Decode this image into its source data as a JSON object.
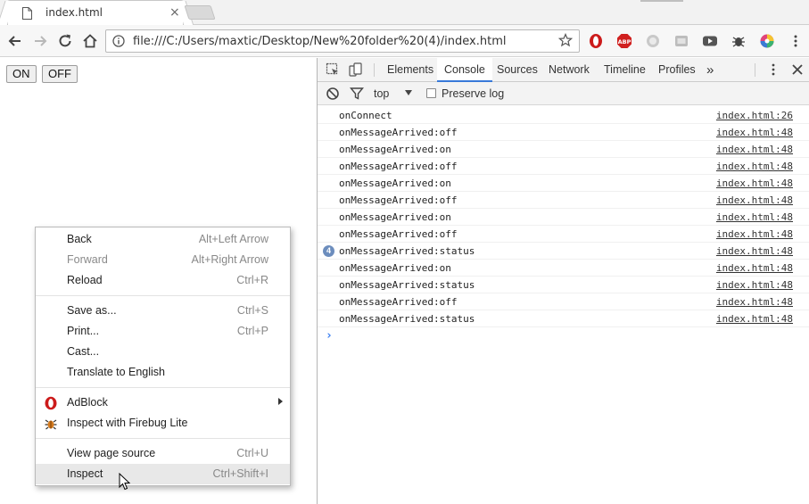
{
  "browser": {
    "tab_title": "index.html",
    "tab_close": "×",
    "url": "file:///C:/Users/maxtic/Desktop/New%20folder%20(4)/index.html"
  },
  "page": {
    "buttons": [
      "ON",
      "OFF"
    ]
  },
  "devtools": {
    "tabs": [
      "Elements",
      "Console",
      "Sources",
      "Network",
      "Timeline",
      "Profiles"
    ],
    "active_tab": "Console",
    "more": "»",
    "context": "top",
    "preserve_log": "Preserve log",
    "preserve_log_checked": false,
    "console_rows": [
      {
        "msg": "onConnect",
        "src": "index.html:26",
        "count": ""
      },
      {
        "msg": "onMessageArrived:off",
        "src": "index.html:48",
        "count": ""
      },
      {
        "msg": "onMessageArrived:on",
        "src": "index.html:48",
        "count": ""
      },
      {
        "msg": "onMessageArrived:off",
        "src": "index.html:48",
        "count": ""
      },
      {
        "msg": "onMessageArrived:on",
        "src": "index.html:48",
        "count": ""
      },
      {
        "msg": "onMessageArrived:off",
        "src": "index.html:48",
        "count": ""
      },
      {
        "msg": "onMessageArrived:on",
        "src": "index.html:48",
        "count": ""
      },
      {
        "msg": "onMessageArrived:off",
        "src": "index.html:48",
        "count": ""
      },
      {
        "msg": "onMessageArrived:status",
        "src": "index.html:48",
        "count": "4"
      },
      {
        "msg": "onMessageArrived:on",
        "src": "index.html:48",
        "count": ""
      },
      {
        "msg": "onMessageArrived:status",
        "src": "index.html:48",
        "count": ""
      },
      {
        "msg": "onMessageArrived:off",
        "src": "index.html:48",
        "count": ""
      },
      {
        "msg": "onMessageArrived:status",
        "src": "index.html:48",
        "count": ""
      }
    ],
    "prompt": "›"
  },
  "context_menu": {
    "groups": [
      [
        {
          "label": "Back",
          "shortcut": "Alt+Left Arrow",
          "disabled": false,
          "icon": ""
        },
        {
          "label": "Forward",
          "shortcut": "Alt+Right Arrow",
          "disabled": true,
          "icon": ""
        },
        {
          "label": "Reload",
          "shortcut": "Ctrl+R",
          "disabled": false,
          "icon": ""
        }
      ],
      [
        {
          "label": "Save as...",
          "shortcut": "Ctrl+S",
          "disabled": false,
          "icon": ""
        },
        {
          "label": "Print...",
          "shortcut": "Ctrl+P",
          "disabled": false,
          "icon": ""
        },
        {
          "label": "Cast...",
          "shortcut": "",
          "disabled": false,
          "icon": ""
        },
        {
          "label": "Translate to English",
          "shortcut": "",
          "disabled": false,
          "icon": ""
        }
      ],
      [
        {
          "label": "AdBlock",
          "shortcut": "",
          "disabled": false,
          "icon": "opera-adblock-icon",
          "submenu": true
        },
        {
          "label": "Inspect with Firebug Lite",
          "shortcut": "",
          "disabled": false,
          "icon": "firebug-icon"
        }
      ],
      [
        {
          "label": "View page source",
          "shortcut": "Ctrl+U",
          "disabled": false,
          "icon": ""
        },
        {
          "label": "Inspect",
          "shortcut": "Ctrl+Shift+I",
          "disabled": false,
          "icon": "",
          "hover": true
        }
      ]
    ]
  },
  "colors": {
    "devtools_accent": "#3879d9",
    "prompt_blue": "#367cf1",
    "badge_blue": "#6c8dbd",
    "opera_red": "#cc1b1b",
    "abp_red": "#d0201f"
  }
}
